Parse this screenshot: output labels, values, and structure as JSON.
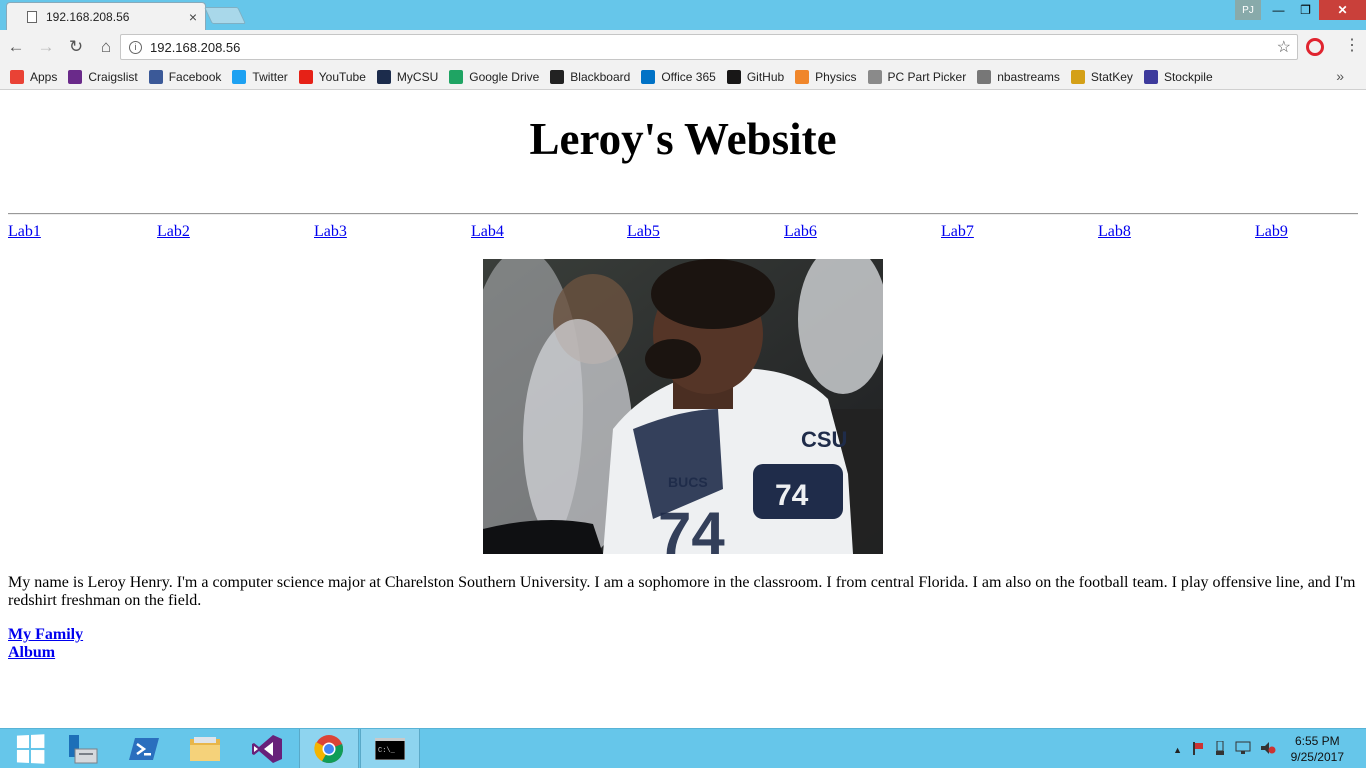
{
  "browser": {
    "tab_title": "192.168.208.56",
    "tab_close": "×",
    "url": "192.168.208.56",
    "window": {
      "profile": "PJ",
      "minimize": "—",
      "maximize": "❐",
      "close": "✕"
    },
    "nav": {
      "back": "←",
      "forward": "→",
      "reload": "↻",
      "home": "⌂",
      "star": "☆",
      "menu": "⋮",
      "info": "i"
    }
  },
  "bookmarks": {
    "items": [
      {
        "label": "Apps",
        "icon": "apps-grid-icon",
        "color": "#e94235"
      },
      {
        "label": "Craigslist",
        "icon": "peace-icon",
        "color": "#6a2a8a"
      },
      {
        "label": "Facebook",
        "icon": "facebook-icon",
        "color": "#3b5998"
      },
      {
        "label": "Twitter",
        "icon": "twitter-icon",
        "color": "#1da1f2"
      },
      {
        "label": "YouTube",
        "icon": "youtube-icon",
        "color": "#e62117"
      },
      {
        "label": "MyCSU",
        "icon": "mycsu-icon",
        "color": "#1c2c4c"
      },
      {
        "label": "Google Drive",
        "icon": "google-drive-icon",
        "color": "#1fa463"
      },
      {
        "label": "Blackboard",
        "icon": "blackboard-icon",
        "color": "#222222"
      },
      {
        "label": "Office 365",
        "icon": "office-icon",
        "color": "#0072c6"
      },
      {
        "label": "GitHub",
        "icon": "github-icon",
        "color": "#181717"
      },
      {
        "label": "Physics",
        "icon": "physics-icon",
        "color": "#f0862a"
      },
      {
        "label": "PC Part Picker",
        "icon": "box-icon",
        "color": "#8a8a8a"
      },
      {
        "label": "nbastreams",
        "icon": "reddit-icon",
        "color": "#777777"
      },
      {
        "label": "StatKey",
        "icon": "lock-icon",
        "color": "#d4a017"
      },
      {
        "label": "Stockpile",
        "icon": "stockpile-icon",
        "color": "#3d3a9c"
      }
    ],
    "more": "»"
  },
  "page": {
    "title": "Leroy's Website",
    "labs": [
      "Lab1",
      "Lab2",
      "Lab3",
      "Lab4",
      "Lab5",
      "Lab6",
      "Lab7",
      "Lab8",
      "Lab9"
    ],
    "bio": "My name is Leroy Henry. I'm a computer science major at Charelston Southern University. I am a sophomore in the classroom. I from central Florida. I am also on the football team. I play offensive line, and I'm redshirt freshman on the field.",
    "links": {
      "family": "My Family",
      "album": "Album"
    },
    "photo": {
      "helmet_logo": "CSU",
      "chest_text": "BUCS",
      "sleeve_number": "74",
      "jersey_number": "74"
    }
  },
  "taskbar": {
    "clock_time": "6:55 PM",
    "clock_date": "9/25/2017",
    "tray_up": "▲",
    "cmd_glyph": "C:\\_"
  }
}
